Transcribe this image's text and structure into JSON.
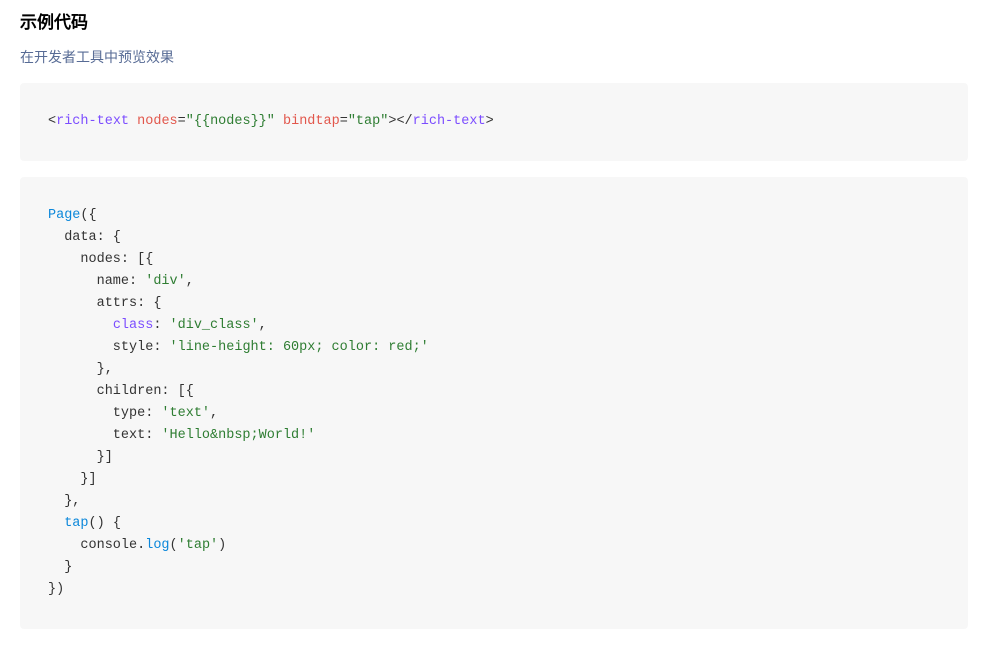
{
  "heading": "示例代码",
  "preview_link": "在开发者工具中预览效果",
  "code_html": {
    "lt1": "<",
    "tag_open": "rich-text",
    "sp": " ",
    "attr1": "nodes",
    "eq": "=",
    "val1": "\"{{nodes}}\"",
    "attr2": "bindtap",
    "val2": "\"tap\"",
    "gt1": ">",
    "lt2": "</",
    "tag_close": "rich-text",
    "gt2": ">"
  },
  "code_js": {
    "l01a": "Page",
    "l01b": "({",
    "l02": "  data: {",
    "l03": "    nodes: [{",
    "l04a": "      name: ",
    "l04b": "'div'",
    "l04c": ",",
    "l05": "      attrs: {",
    "l06a": "        ",
    "l06b": "class",
    "l06c": ": ",
    "l06d": "'div_class'",
    "l06e": ",",
    "l07a": "        style: ",
    "l07b": "'line-height: 60px; color: red;'",
    "l08": "      },",
    "l09": "      children: [{",
    "l10a": "        type: ",
    "l10b": "'text'",
    "l10c": ",",
    "l11a": "        text: ",
    "l11b": "'Hello&nbsp;World!'",
    "l12": "      }]",
    "l13": "    }]",
    "l14": "  },",
    "l15a": "  ",
    "l15b": "tap",
    "l15c": "() {",
    "l16a": "    console.",
    "l16b": "log",
    "l16c": "(",
    "l16d": "'tap'",
    "l16e": ")",
    "l17": "  }",
    "l18": "})"
  }
}
